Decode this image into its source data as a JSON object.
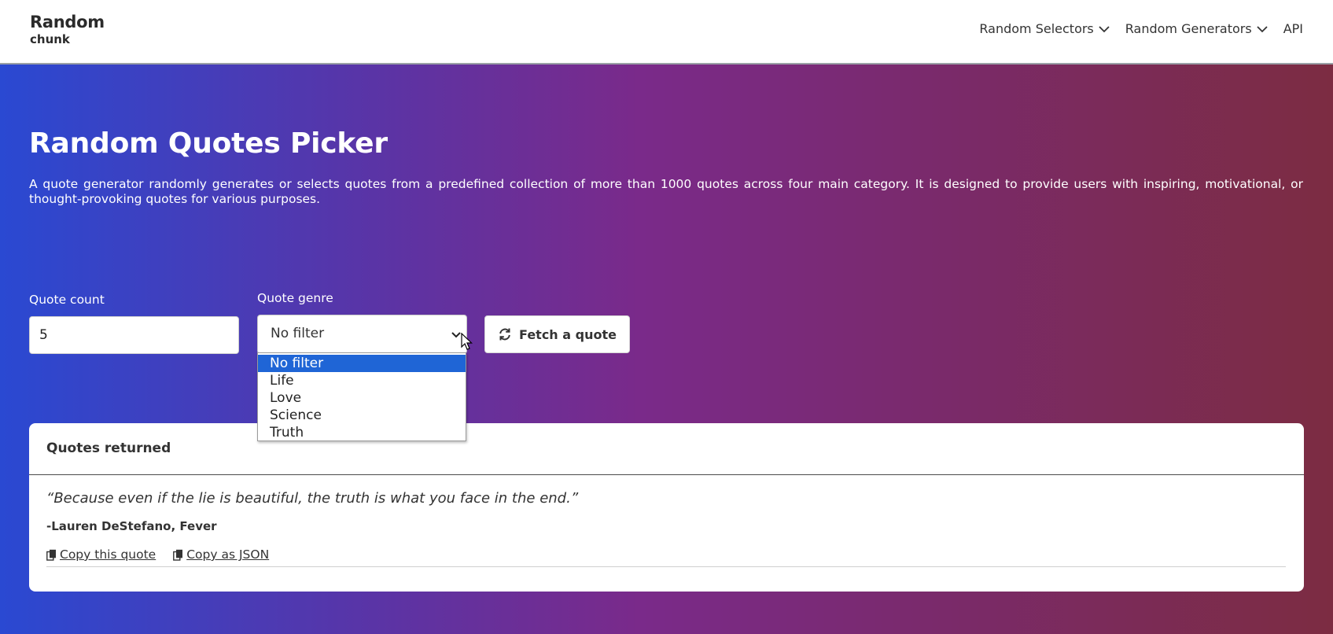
{
  "brand": {
    "title": "Random",
    "subtitle": "chunk"
  },
  "nav": {
    "items": [
      {
        "label": "Random Selectors",
        "icon": "chevron-down-icon"
      },
      {
        "label": "Random Generators",
        "icon": "chevron-down-icon"
      },
      {
        "label": "API"
      }
    ]
  },
  "page": {
    "title": "Random Quotes Picker",
    "description": "A quote generator randomly generates or selects quotes from a predefined collection of more than 1000 quotes across four main category. It is designed to provide users with inspiring, motivational, or thought-provoking quotes for various purposes."
  },
  "form": {
    "count_label": "Quote count",
    "count_value": "5",
    "genre_label": "Quote genre",
    "genre_selected": "No filter",
    "genre_options": [
      "No filter",
      "Life",
      "Love",
      "Science",
      "Truth"
    ],
    "fetch_label": "Fetch a quote",
    "fetch_icon": "refresh-icon"
  },
  "results": {
    "title": "Quotes returned",
    "quotes": [
      {
        "text": "“Because even if the lie is beautiful, the truth is what you face in the end.”",
        "author": "-Lauren DeStefano, Fever",
        "copy_label": "Copy this quote",
        "copy_json_label": "Copy as JSON"
      }
    ]
  },
  "colors": {
    "gradient_start": "#2a49d2",
    "gradient_mid": "#7a2a8a",
    "gradient_end": "#7c2c42",
    "selected_option": "#1f65d6"
  }
}
